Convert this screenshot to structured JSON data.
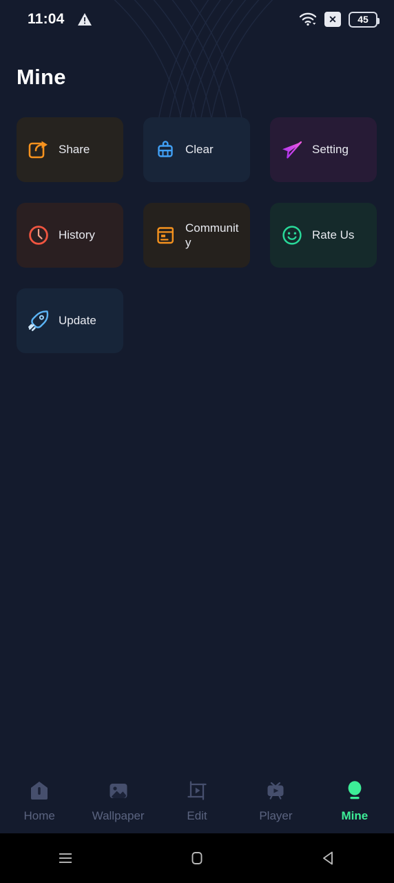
{
  "status_bar": {
    "time": "11:04",
    "warning_icon": "warning-triangle-icon",
    "wifi_icon": "wifi-icon",
    "sim_icon": "no-sim-icon",
    "sim_glyph": "✕",
    "battery_level": "45"
  },
  "header": {
    "title": "Mine"
  },
  "colors": {
    "background": "#141b2d",
    "accent": "#3ded97",
    "share": "#f5921e",
    "clear": "#41a0f5",
    "setting": "#d04cf0",
    "history": "#f05540",
    "community": "#f5921e",
    "rate": "#29d999",
    "update": "#5bb4f5",
    "nav_inactive": "#5b6480"
  },
  "grid": {
    "items": [
      {
        "label": "Share",
        "icon": "share-icon",
        "bg": "#26231f",
        "color": "#f5921e"
      },
      {
        "label": "Clear",
        "icon": "broom-icon",
        "bg": "#182539",
        "color": "#41a0f5"
      },
      {
        "label": "Setting",
        "icon": "paper-plane-icon",
        "bg": "#271b36",
        "color": "#d04cf0"
      },
      {
        "label": "History",
        "icon": "clock-icon",
        "bg": "#2a1f21",
        "color": "#f05540"
      },
      {
        "label": "Community",
        "icon": "book-icon",
        "bg": "#25211d",
        "color": "#f5921e"
      },
      {
        "label": "Rate Us",
        "icon": "smiley-icon",
        "bg": "#152a2b",
        "color": "#29d999"
      },
      {
        "label": "Update",
        "icon": "rocket-icon",
        "bg": "#172539",
        "color": "#5bb4f5"
      }
    ]
  },
  "bottom_nav": {
    "items": [
      {
        "label": "Home",
        "icon": "home-icon",
        "active": false
      },
      {
        "label": "Wallpaper",
        "icon": "image-icon",
        "active": false
      },
      {
        "label": "Edit",
        "icon": "crop-play-icon",
        "active": false
      },
      {
        "label": "Player",
        "icon": "tv-play-icon",
        "active": false
      },
      {
        "label": "Mine",
        "icon": "person-icon",
        "active": true
      }
    ]
  },
  "system_nav": {
    "recents_label": "recents-icon",
    "home_label": "home-square-icon",
    "back_label": "back-triangle-icon"
  }
}
